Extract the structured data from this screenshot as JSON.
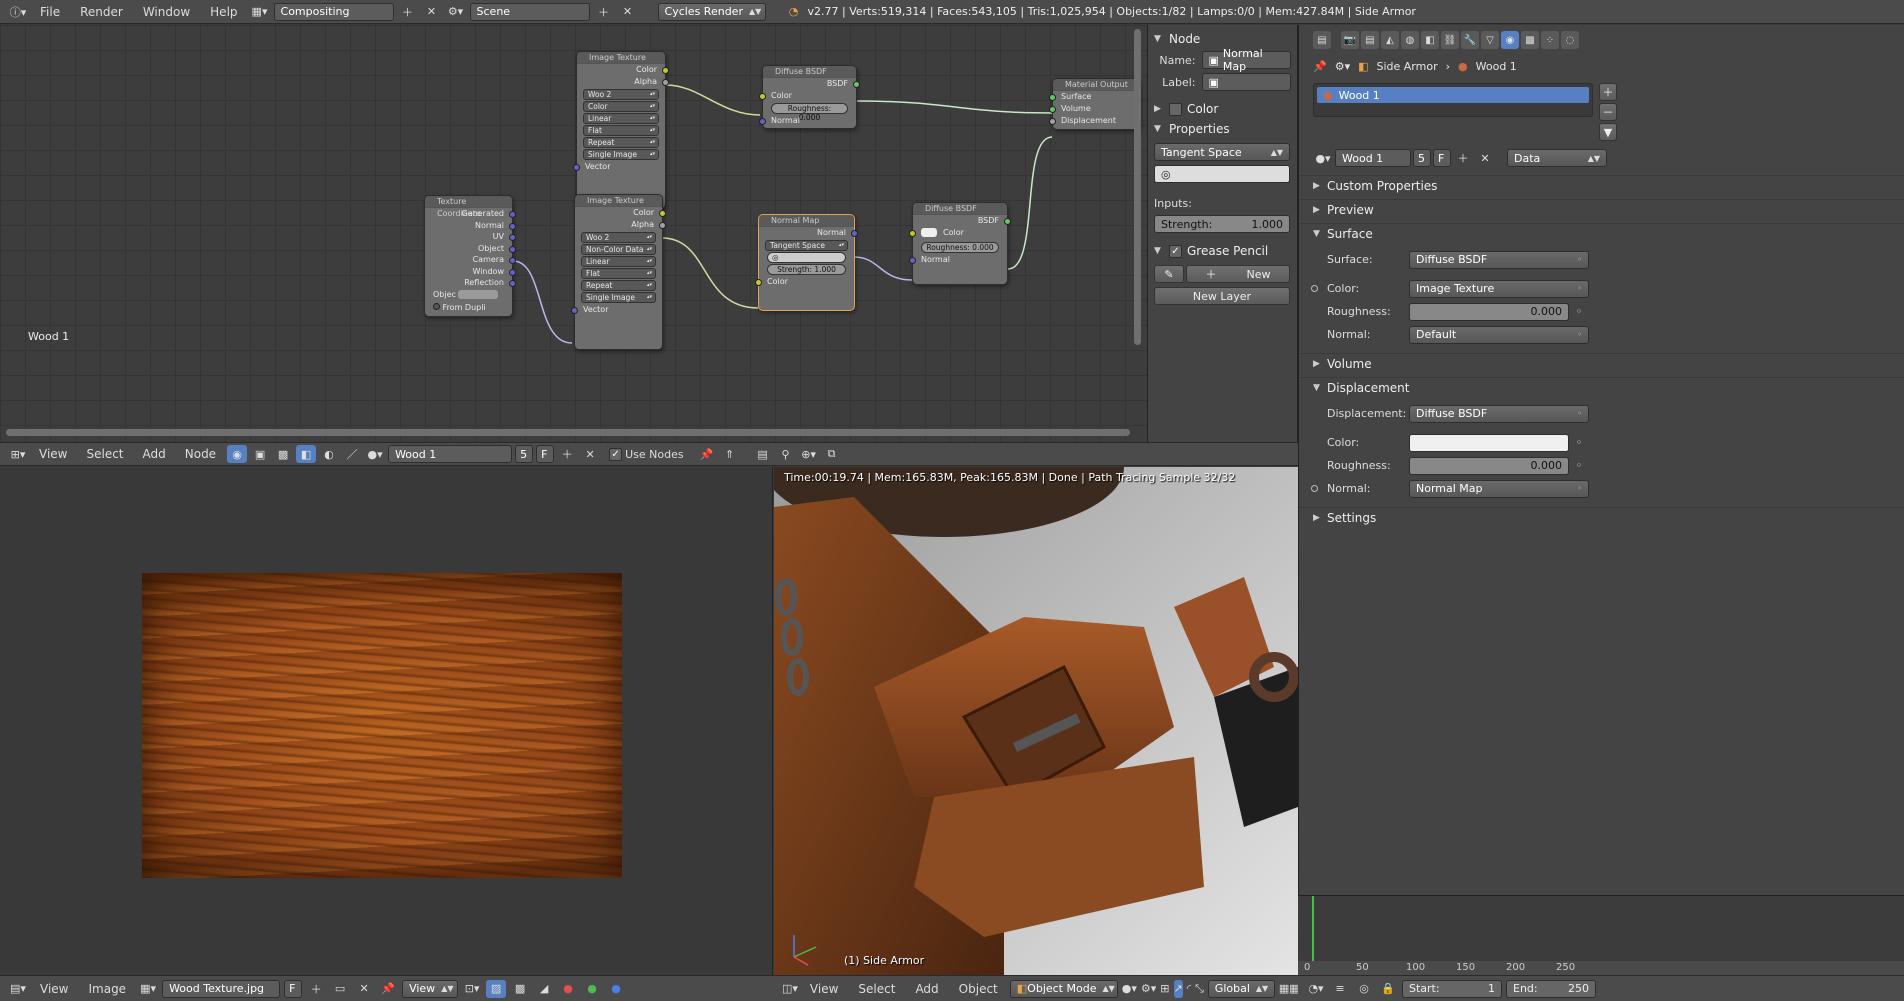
{
  "topbar": {
    "menus": [
      "File",
      "Render",
      "Window",
      "Help"
    ],
    "screen_layout": "Compositing",
    "scene": "Scene",
    "render_engine": "Cycles Render",
    "stats": "v2.77 | Verts:519,314 | Faces:543,105 | Tris:1,025,954 | Objects:1/82 | Lamps:0/0 | Mem:427.84M | Side Armor"
  },
  "node_editor": {
    "label": "Wood 1",
    "nodes": {
      "image_texture_1": {
        "title": "Image Texture",
        "outputs": [
          "Color",
          "Alpha"
        ],
        "image": "Woo 2",
        "settings": [
          "Color",
          "Linear",
          "Flat",
          "Repeat",
          "Single Image"
        ],
        "input": "Vector"
      },
      "diffuse_1": {
        "title": "Diffuse BSDF",
        "output": "BSDF",
        "inputs": [
          "Color",
          "Roughness: 0.000",
          "Normal"
        ]
      },
      "material_output": {
        "title": "Material Output",
        "inputs": [
          "Surface",
          "Volume",
          "Displacement"
        ]
      },
      "tex_coord": {
        "title": "Texture Coordinate",
        "outputs": [
          "Generated",
          "Normal",
          "UV",
          "Object",
          "Camera",
          "Window",
          "Reflection"
        ],
        "object_label": "Objec",
        "from_dupli": "From Dupli"
      },
      "image_texture_2": {
        "title": "Image Texture",
        "outputs": [
          "Color",
          "Alpha"
        ],
        "image": "Woo 2",
        "settings": [
          "Non-Color Data",
          "Linear",
          "Flat",
          "Repeat",
          "Single Image"
        ],
        "input": "Vector"
      },
      "normal_map": {
        "title": "Normal Map",
        "output": "Normal",
        "space": "Tangent Space",
        "strength": "Strength: 1.000",
        "input": "Color"
      },
      "diffuse_2": {
        "title": "Diffuse BSDF",
        "output": "BSDF",
        "inputs": [
          "Color",
          "Roughness: 0.000",
          "Normal"
        ]
      }
    }
  },
  "node_panel": {
    "node_section": "Node",
    "name_label": "Name:",
    "name_value": "Normal Map",
    "label_label": "Label:",
    "label_value": "",
    "color_section": "Color",
    "properties_section": "Properties",
    "space": "Tangent Space",
    "inputs_label": "Inputs:",
    "strength_label": "Strength:",
    "strength_value": "1.000",
    "grease_pencil_section": "Grease Pencil",
    "new_button": "New",
    "new_layer_button": "New Layer"
  },
  "ne_header": {
    "menus": [
      "View",
      "Select",
      "Add",
      "Node"
    ],
    "material": "Wood 1",
    "users": "5",
    "fake": "F",
    "use_nodes": "Use Nodes"
  },
  "image_editor": {
    "menus": [
      "View",
      "Image"
    ],
    "image_name": "Wood Texture.jpg",
    "fake": "F",
    "view_menu": "View"
  },
  "viewport": {
    "status": "Time:00:19.74 | Mem:165.83M, Peak:165.83M | Done | Path Tracing Sample 32/32",
    "object_name": "(1) Side Armor",
    "menus": [
      "View",
      "Select",
      "Add",
      "Object"
    ],
    "mode": "Object Mode",
    "orientation": "Global"
  },
  "properties": {
    "crumb_object": "Side Armor",
    "crumb_material": "Wood 1",
    "slot_name": "Wood 1",
    "material_name": "Wood 1",
    "users": "5",
    "fake": "F",
    "link": "Data",
    "sections": {
      "custom_properties": "Custom Properties",
      "preview": "Preview",
      "surface": "Surface",
      "volume": "Volume",
      "displacement": "Displacement",
      "settings": "Settings"
    },
    "surface": {
      "surface_label": "Surface:",
      "surface_value": "Diffuse BSDF",
      "color_label": "Color:",
      "color_value": "Image Texture",
      "roughness_label": "Roughness:",
      "roughness_value": "0.000",
      "normal_label": "Normal:",
      "normal_value": "Default"
    },
    "displacement": {
      "displacement_label": "Displacement:",
      "displacement_value": "Diffuse BSDF",
      "color_label": "Color:",
      "roughness_label": "Roughness:",
      "roughness_value": "0.000",
      "normal_label": "Normal:",
      "normal_value": "Normal Map"
    }
  },
  "timeline": {
    "ticks": [
      "0",
      "50",
      "100",
      "150",
      "200",
      "250"
    ],
    "start_label": "Start:",
    "start_value": "1",
    "end_label": "End:",
    "end_value": "250"
  },
  "colors": {
    "accent": "#5680c2",
    "active_node_border": "#e8a24a",
    "frame_cursor": "#4dbb4d"
  }
}
